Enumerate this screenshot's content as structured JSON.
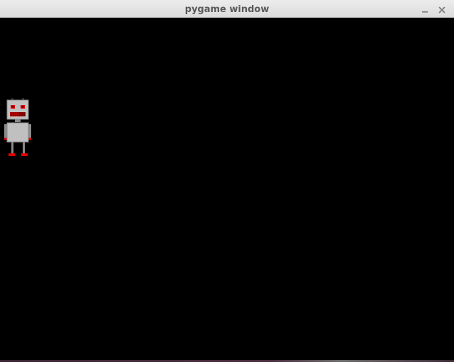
{
  "window": {
    "title": "pygame window",
    "controls": {
      "minimize_icon": "minimize-icon",
      "close_icon": "close-icon"
    }
  },
  "game": {
    "background": "#000000",
    "sprites": [
      {
        "kind": "robot",
        "body_color": "#c0c0c0",
        "accent_color": "#e00000"
      }
    ]
  }
}
